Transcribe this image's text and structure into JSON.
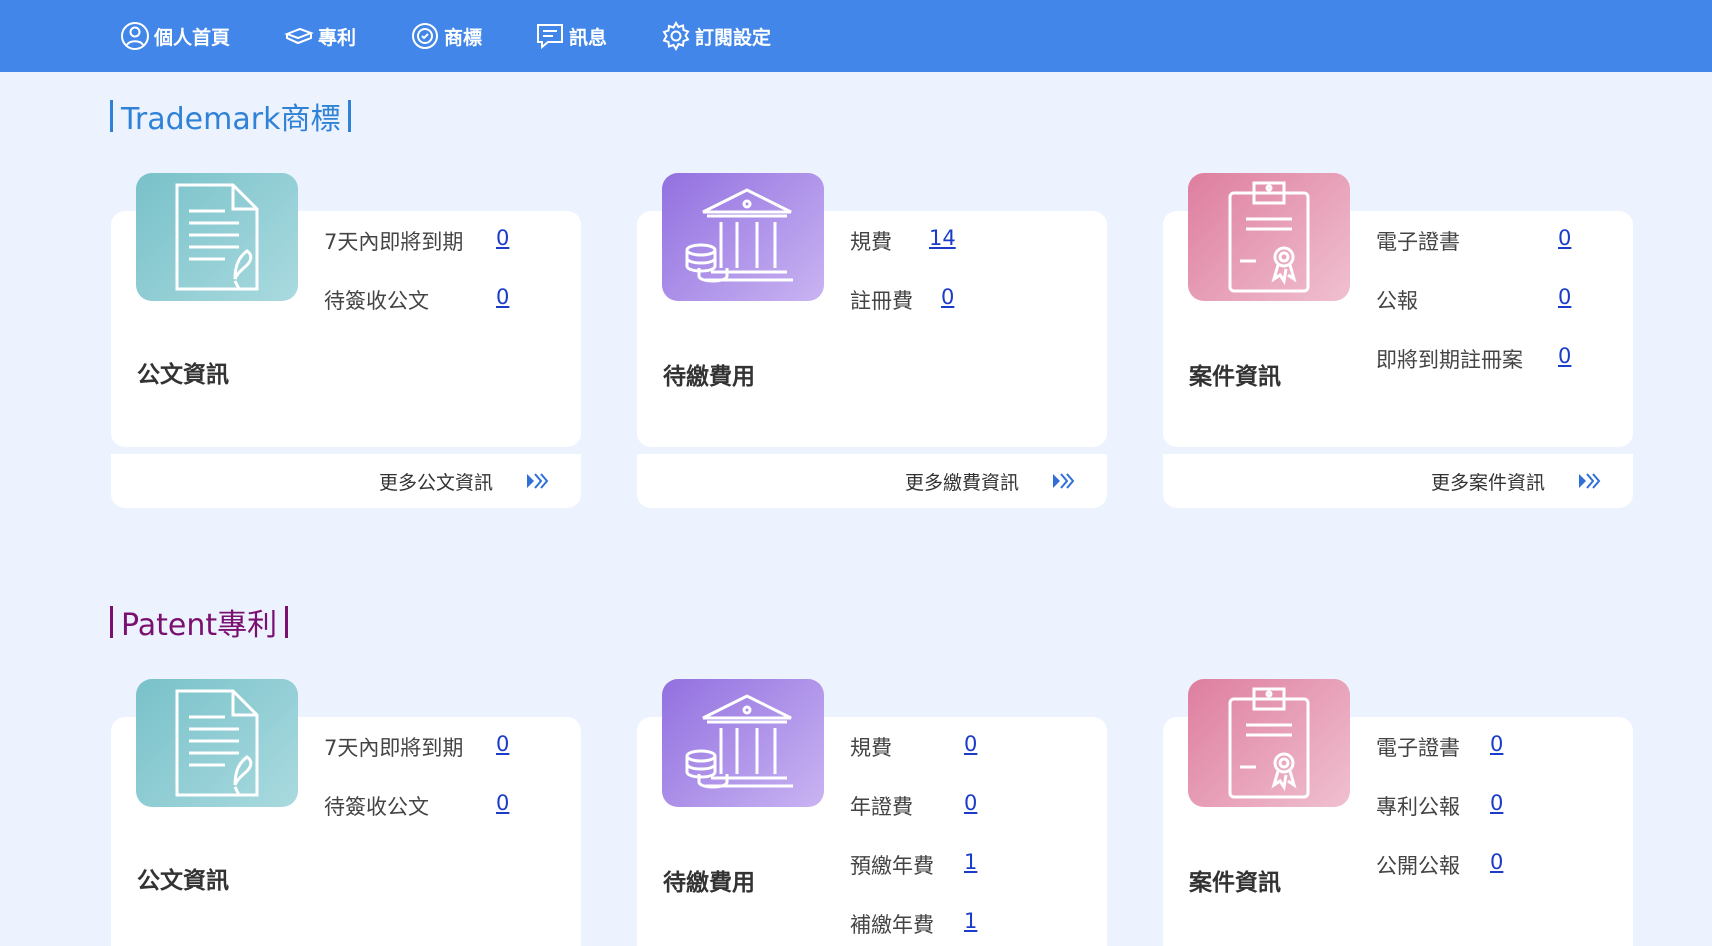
{
  "nav": [
    {
      "label": "個人首頁",
      "icon": "user-icon"
    },
    {
      "label": "專利",
      "icon": "book-icon"
    },
    {
      "label": "商標",
      "icon": "badge-icon"
    },
    {
      "label": "訊息",
      "icon": "message-icon"
    },
    {
      "label": "訂閱設定",
      "icon": "gear-icon"
    }
  ],
  "trademark": {
    "title": "Trademark商標",
    "documents": {
      "label": "公文資訊",
      "stats": [
        {
          "label": "7天內即將到期",
          "value": "0"
        },
        {
          "label": "待簽收公文",
          "value": "0"
        }
      ],
      "more": "更多公文資訊"
    },
    "fees": {
      "label": "待繳費用",
      "stats": [
        {
          "label": "規費",
          "value": "14"
        },
        {
          "label": "註冊費",
          "value": "0"
        }
      ],
      "more": "更多繳費資訊"
    },
    "cases": {
      "label": "案件資訊",
      "stats": [
        {
          "label": "電子證書",
          "value": "0"
        },
        {
          "label": "公報",
          "value": "0"
        },
        {
          "label": "即將到期註冊案",
          "value": "0"
        }
      ],
      "more": "更多案件資訊"
    }
  },
  "patent": {
    "title": "Patent專利",
    "documents": {
      "label": "公文資訊",
      "stats": [
        {
          "label": "7天內即將到期",
          "value": "0"
        },
        {
          "label": "待簽收公文",
          "value": "0"
        }
      ]
    },
    "fees": {
      "label": "待繳費用",
      "stats": [
        {
          "label": "規費",
          "value": "0"
        },
        {
          "label": "年證費",
          "value": "0"
        },
        {
          "label": "預繳年費",
          "value": "1"
        },
        {
          "label": "補繳年費",
          "value": "1"
        }
      ]
    },
    "cases": {
      "label": "案件資訊",
      "stats": [
        {
          "label": "電子證書",
          "value": "0"
        },
        {
          "label": "專利公報",
          "value": "0"
        },
        {
          "label": "公開公報",
          "value": "0"
        }
      ]
    }
  }
}
